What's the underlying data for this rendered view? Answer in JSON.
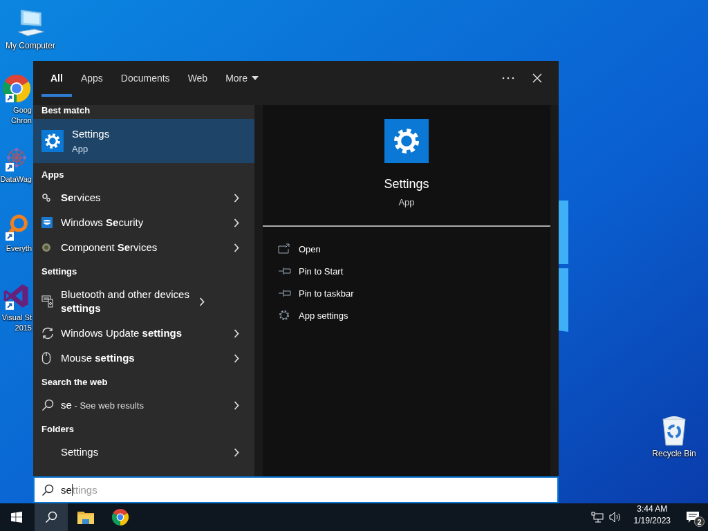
{
  "desktop_icons": [
    {
      "kind": "computer",
      "label_lines": [
        "My Computer"
      ],
      "shortcut": false
    },
    {
      "kind": "chrome",
      "label_lines": [
        "Goog",
        "Chron"
      ],
      "shortcut": true
    },
    {
      "kind": "molecule",
      "label_lines": [
        "DataWag"
      ],
      "shortcut": true
    },
    {
      "kind": "magnifier",
      "label_lines": [
        "Everyth"
      ],
      "shortcut": true
    },
    {
      "kind": "visualstudio",
      "label_lines": [
        "Visual St",
        "2015"
      ],
      "shortcut": true
    },
    {
      "kind": "recycle",
      "label_lines": [
        "Recycle Bin"
      ],
      "shortcut": false
    }
  ],
  "search_panel": {
    "tabs": [
      {
        "label": "All",
        "selected": true,
        "dropdown": false
      },
      {
        "label": "Apps",
        "selected": false,
        "dropdown": false
      },
      {
        "label": "Documents",
        "selected": false,
        "dropdown": false
      },
      {
        "label": "Web",
        "selected": false,
        "dropdown": false
      },
      {
        "label": "More",
        "selected": false,
        "dropdown": true
      }
    ],
    "best_match": {
      "header": "Best match",
      "title": "Settings",
      "subtitle": "App",
      "selected": true
    },
    "sections": [
      {
        "title": "Apps",
        "items": [
          {
            "label": "**Se**rvices"
          },
          {
            "label": "Windows **Se**curity"
          },
          {
            "label": "Component **Se**rvices"
          }
        ]
      },
      {
        "title": "Settings",
        "items": [
          {
            "label": "Bluetooth and other devices **settings**"
          },
          {
            "label": "Windows Update **settings**"
          },
          {
            "label": "Mouse **settings**"
          }
        ]
      },
      {
        "title": "Search the web",
        "items": [
          {
            "label": "se",
            "hint": "- See web results"
          }
        ]
      },
      {
        "title": "Folders",
        "items": [
          {
            "label": "Settings"
          }
        ]
      }
    ],
    "preview": {
      "title": "Settings",
      "subtitle": "App",
      "actions": [
        {
          "label": "Open"
        },
        {
          "label": "Pin to Start"
        },
        {
          "label": "Pin to taskbar"
        },
        {
          "label": "App settings"
        }
      ]
    },
    "search_box": {
      "value": "se",
      "suggestion": "ttings"
    }
  },
  "taskbar": {
    "buttons": [
      {
        "kind": "start",
        "selected": false
      },
      {
        "kind": "search",
        "selected": true
      },
      {
        "kind": "explorer",
        "selected": false
      },
      {
        "kind": "chrome",
        "selected": false
      }
    ],
    "time": "3:44 AM",
    "date": "1/19/2023",
    "notification_count": "2"
  }
}
